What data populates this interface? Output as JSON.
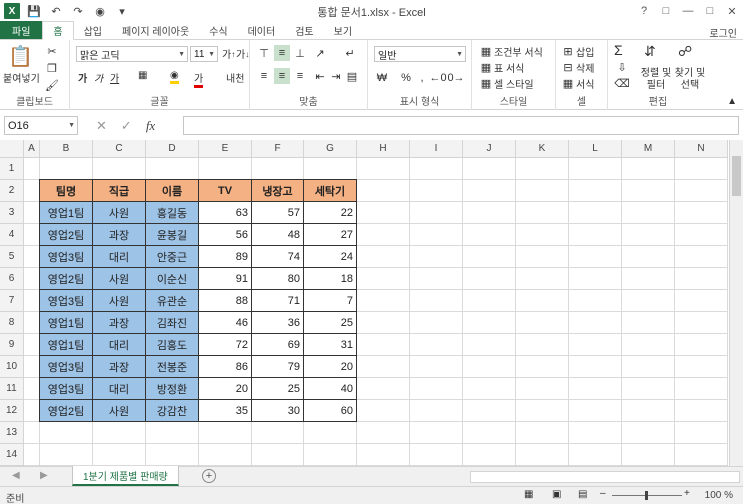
{
  "window": {
    "title": "통합 문서1.xlsx - Excel",
    "app_icon": "X",
    "login_label": "로그인"
  },
  "ribbon_tabs": [
    "파일",
    "홈",
    "삽입",
    "페이지 레이아웃",
    "수식",
    "데이터",
    "검토",
    "보기"
  ],
  "ribbon": {
    "paste_label": "붙여넣기",
    "font_name": "맑은 고딕",
    "font_size": "11",
    "number_format": "일반",
    "cond_format": "조건부 서식",
    "table_format": "표 서식",
    "cell_style": "셀 스타일",
    "insert": "삽입",
    "delete": "삭제",
    "format": "서식",
    "sort_filter": "정렬 및 필터",
    "find_select": "찾기 및 선택",
    "groups": {
      "clipboard": "클립보드",
      "font": "글꼴",
      "alignment": "맞춤",
      "number": "표시 형식",
      "styles": "스타일",
      "cells": "셀",
      "editing": "편집"
    },
    "accent_color": "#217346"
  },
  "formula_bar": {
    "name_box": "O16",
    "fx": "fx",
    "value": ""
  },
  "columns": [
    "A",
    "B",
    "C",
    "D",
    "E",
    "F",
    "G",
    "H",
    "I",
    "J",
    "K",
    "L",
    "M",
    "N"
  ],
  "rows": [
    "1",
    "2",
    "3",
    "4",
    "5",
    "6",
    "7",
    "8",
    "9",
    "10",
    "11",
    "12",
    "13",
    "14"
  ],
  "table": {
    "headers": [
      "팀명",
      "직급",
      "이름",
      "TV",
      "냉장고",
      "세탁기"
    ],
    "rows": [
      [
        "영업1팀",
        "사원",
        "홍길동",
        "63",
        "57",
        "22"
      ],
      [
        "영업2팀",
        "과장",
        "윤봉길",
        "56",
        "48",
        "27"
      ],
      [
        "영업3팀",
        "대리",
        "안중근",
        "89",
        "74",
        "24"
      ],
      [
        "영업2팀",
        "사원",
        "이순신",
        "91",
        "80",
        "18"
      ],
      [
        "영업3팀",
        "사원",
        "유관순",
        "88",
        "71",
        "7"
      ],
      [
        "영업1팀",
        "과장",
        "김좌진",
        "46",
        "36",
        "25"
      ],
      [
        "영업1팀",
        "대리",
        "김홍도",
        "72",
        "69",
        "31"
      ],
      [
        "영업3팀",
        "과장",
        "전봉준",
        "86",
        "79",
        "20"
      ],
      [
        "영업3팀",
        "대리",
        "방정환",
        "20",
        "25",
        "40"
      ],
      [
        "영업2팀",
        "사원",
        "강감찬",
        "35",
        "30",
        "60"
      ]
    ],
    "header_color": "#f4b183",
    "text_cell_color": "#9dc3e6"
  },
  "sheet_tab": "1분기 제품별 판매량",
  "status": {
    "ready": "준비",
    "zoom": "100 %"
  }
}
